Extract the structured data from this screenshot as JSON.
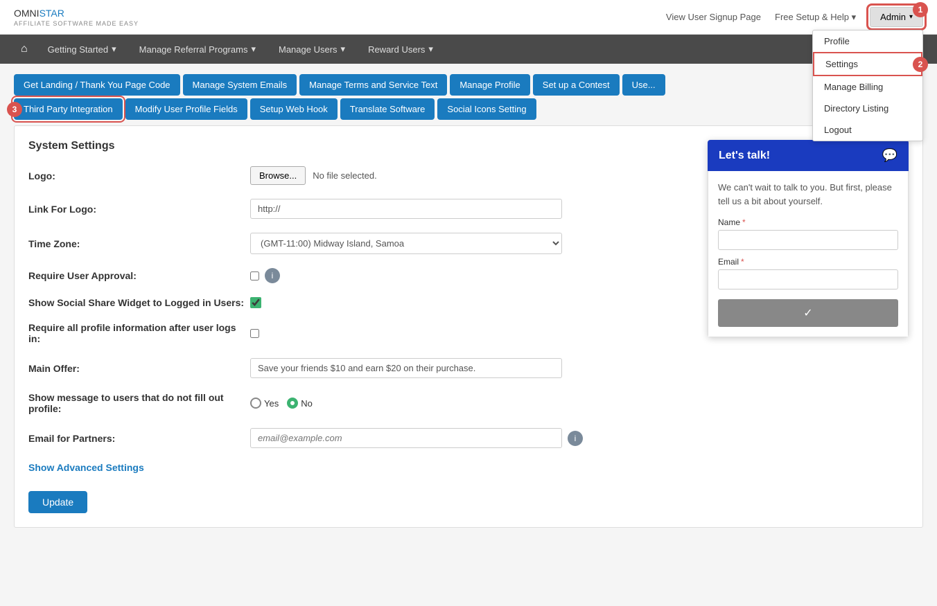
{
  "header": {
    "logo_omni": "OMNI",
    "logo_star": "STAR",
    "logo_tagline": "AFFILIATE SOFTWARE MADE EASY",
    "view_signup": "View User Signup Page",
    "free_setup": "Free Setup & Help",
    "free_setup_caret": "▾",
    "admin_label": "Admin",
    "admin_caret": "▾"
  },
  "admin_dropdown": {
    "profile": "Profile",
    "settings": "Settings",
    "manage_billing": "Manage Billing",
    "directory_listing": "Directory Listing",
    "logout": "Logout"
  },
  "steps": {
    "step1": "1",
    "step2": "2",
    "step3": "3"
  },
  "navbar": {
    "home_icon": "⌂",
    "items": [
      {
        "label": "Getting Started",
        "caret": "▾"
      },
      {
        "label": "Manage Referral Programs",
        "caret": "▾"
      },
      {
        "label": "Manage Users",
        "caret": "▾"
      },
      {
        "label": "Reward Users",
        "caret": "▾"
      }
    ]
  },
  "tabs_row1": [
    {
      "label": "Get Landing / Thank You Page Code",
      "active": false
    },
    {
      "label": "Manage System Emails",
      "active": false
    },
    {
      "label": "Manage Terms and Service Text",
      "active": false
    },
    {
      "label": "Manage Profile",
      "active": false
    },
    {
      "label": "Set up a Contest",
      "active": false
    },
    {
      "label": "Use...",
      "active": false
    }
  ],
  "tabs_row2": [
    {
      "label": "Third Party Integration",
      "active": true
    },
    {
      "label": "Modify User Profile Fields",
      "active": false
    },
    {
      "label": "Setup Web Hook",
      "active": false
    },
    {
      "label": "Translate Software",
      "active": false
    },
    {
      "label": "Social Icons Setting",
      "active": false
    }
  ],
  "panel": {
    "title": "System Settings",
    "fields": {
      "logo_label": "Logo:",
      "browse_btn": "Browse...",
      "no_file": "No file selected.",
      "link_logo_label": "Link For Logo:",
      "link_logo_value": "http://",
      "link_logo_placeholder": "http://",
      "timezone_label": "Time Zone:",
      "timezone_value": "(GMT-11:00) Midway Island, Samoa",
      "require_approval_label": "Require User Approval:",
      "social_share_label": "Show Social Share Widget to Logged in Users:",
      "require_profile_label": "Require all profile information after user logs in:",
      "main_offer_label": "Main Offer:",
      "main_offer_value": "Save your friends $10 and earn $20 on their purchase.",
      "main_offer_placeholder": "Save your friends $10 and earn $20 on their purchase.",
      "show_message_label": "Show message to users that do not fill out profile:",
      "yes_label": "Yes",
      "no_label": "No",
      "email_partners_label": "Email for Partners:",
      "email_partners_placeholder": "email@example.com"
    },
    "advanced_link": "Show Advanced Settings",
    "update_btn": "Update"
  },
  "chat": {
    "title": "Let's talk!",
    "description": "We can't wait to talk to you. But first, please tell us a bit about yourself.",
    "name_label": "Name",
    "email_label": "Email",
    "required_star": "*",
    "submit_icon": "✓"
  }
}
